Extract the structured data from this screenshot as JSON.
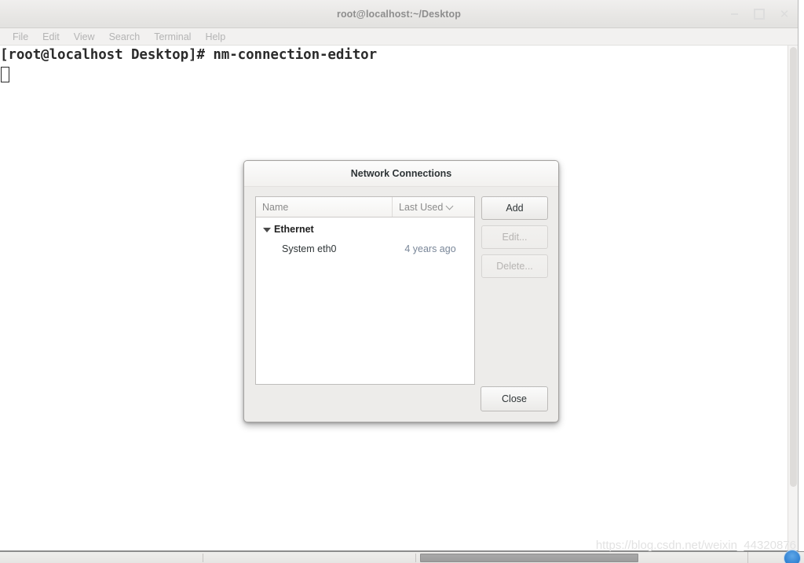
{
  "terminal": {
    "title": "root@localhost:~/Desktop",
    "menu": [
      {
        "label": "File"
      },
      {
        "label": "Edit"
      },
      {
        "label": "View"
      },
      {
        "label": "Search"
      },
      {
        "label": "Terminal"
      },
      {
        "label": "Help"
      }
    ],
    "window_controls": {
      "minimize": "minimize-icon",
      "maximize": "maximize-icon",
      "close": "close-icon"
    },
    "prompt_line": "[root@localhost Desktop]# nm-connection-editor",
    "cursor": "block-cursor"
  },
  "dialog": {
    "title": "Network Connections",
    "list": {
      "columns": [
        {
          "label": "Name",
          "key": "name"
        },
        {
          "label": "Last Used",
          "key": "last_used",
          "sort_icon": "chevron-down-icon"
        }
      ],
      "groups": [
        {
          "label": "Ethernet",
          "expanded": true,
          "expander_icon": "triangle-down-icon",
          "rows": [
            {
              "name": "System eth0",
              "last_used": "4 years ago"
            }
          ]
        }
      ]
    },
    "buttons": {
      "add": {
        "label": "Add",
        "enabled": true
      },
      "edit": {
        "label": "Edit...",
        "enabled": false
      },
      "delete": {
        "label": "Delete...",
        "enabled": false
      },
      "close": {
        "label": "Close",
        "enabled": true
      }
    }
  },
  "watermark": {
    "text": "https://blog.csdn.net/weixin_44320876"
  },
  "taskbar": {
    "active_task": "",
    "tray_icon": "blue-circle-icon"
  },
  "colors": {
    "dialog_bg": "#edecea",
    "titlebar_bg": "#e8e7e5",
    "text_primary": "#2e3436",
    "text_muted": "#8b8b8b",
    "last_used_accent": "#7a8799",
    "disabled_text": "#b6b4b2",
    "watermark": "#e2e2e2"
  }
}
